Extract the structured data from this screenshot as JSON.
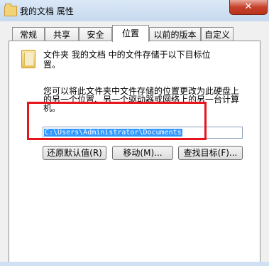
{
  "window": {
    "title": "我的文档 属性",
    "close_label": "✕"
  },
  "tabs": [
    {
      "label": "常规"
    },
    {
      "label": "共享"
    },
    {
      "label": "安全"
    },
    {
      "label": "位置",
      "selected": true
    },
    {
      "label": "以前的版本"
    },
    {
      "label": "自定义"
    }
  ],
  "location": {
    "line1": "文件夹 我的文档 中的文件存储于以下目标位",
    "line2": "置。",
    "desc_line1": "您可以将此文件夹中文件存储的位置更改为此硬盘上",
    "desc_line2": "的另一个位置、另一个驱动器或网络上的另一台计算",
    "desc_line3": "机。",
    "path_value": "C:\\Users\\Administrator\\Documents"
  },
  "buttons": {
    "restore_default": "还原默认值(R)",
    "move": "移动(M)...",
    "find_target": "查找目标(F)..."
  },
  "colors": {
    "highlight_box": "#e8141c",
    "selection": "#3399ff",
    "frame": "#cfe0f3"
  }
}
